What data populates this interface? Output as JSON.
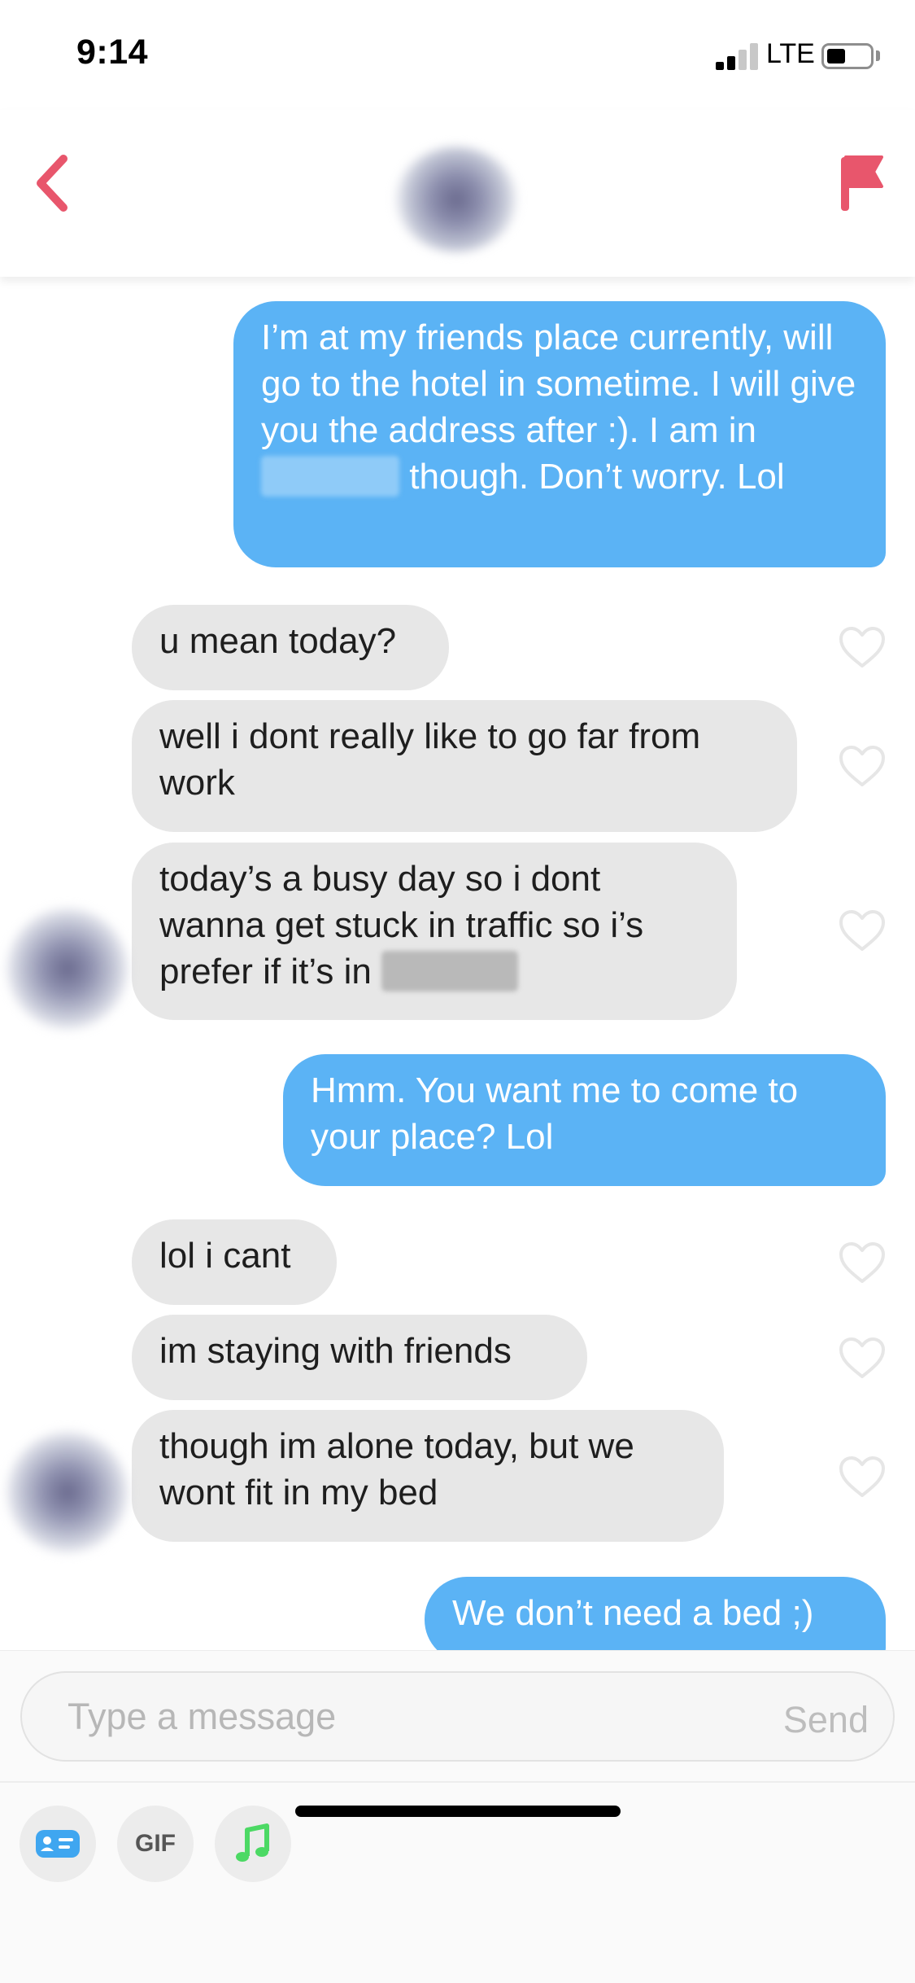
{
  "status_bar": {
    "time": "9:14",
    "network": "LTE"
  },
  "header": {
    "back_icon": "chevron-left-icon",
    "report_icon": "flag-icon",
    "accent_color": "#e8566c"
  },
  "messages": [
    {
      "sender": "me",
      "text_before": "I’m at my friends place currently, will go to the hotel in sometime. I will give you the address after :). I am in",
      "text_after": "though. Don’t worry. Lol"
    },
    {
      "sender": "them",
      "text": "u mean today?"
    },
    {
      "sender": "them",
      "text": "well i dont really like to go far from work"
    },
    {
      "sender": "them",
      "text_before": "today’s a busy day so i dont wanna get stuck in traffic so i’s prefer if it’s in",
      "text_after": ""
    },
    {
      "sender": "me",
      "text": "Hmm. You want me to come to your place? Lol"
    },
    {
      "sender": "them",
      "text": "lol i cant"
    },
    {
      "sender": "them",
      "text": "im staying with friends"
    },
    {
      "sender": "them",
      "text": "though im alone today, but we wont fit in my bed"
    },
    {
      "sender": "me",
      "text": "We don’t need a bed ;)"
    }
  ],
  "composer": {
    "placeholder": "Type a message",
    "send_label": "Send"
  },
  "toolbar": {
    "gif_label": "GIF",
    "contact_icon": "contact-card-icon",
    "music_icon": "music-note-icon"
  },
  "colors": {
    "sent_bubble": "#5bb3f5",
    "received_bubble": "#e7e7e7",
    "music_accent": "#4cd964",
    "contact_accent": "#3fa6f0"
  }
}
